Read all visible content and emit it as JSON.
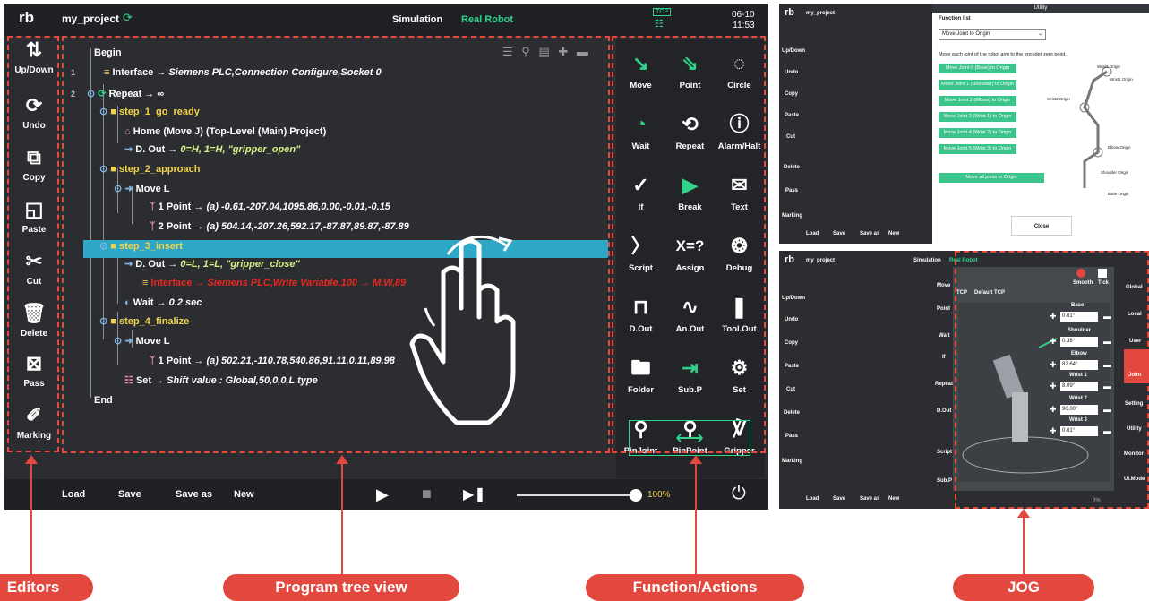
{
  "app": {
    "project": "my_project",
    "tab_sim": "Simulation",
    "tab_real": "Real Robot",
    "tcp": "TCP",
    "date": "06-10",
    "time": "11:53"
  },
  "tools": [
    {
      "label": "Up/Down",
      "icon": "up-down-icon"
    },
    {
      "label": "Undo",
      "icon": "undo-icon"
    },
    {
      "label": "Copy",
      "icon": "copy-icon"
    },
    {
      "label": "Paste",
      "icon": "paste-icon"
    },
    {
      "label": "Cut",
      "icon": "cut-icon"
    },
    {
      "label": "Delete",
      "icon": "delete-icon"
    },
    {
      "label": "Pass",
      "icon": "pass-icon"
    },
    {
      "label": "Marking",
      "icon": "marking-icon"
    }
  ],
  "tree": {
    "begin": "Begin",
    "end": "End",
    "rows": [
      {
        "num": "1",
        "text": "Interface → ",
        "detail": "Siemens PLC,Connection Configure,Socket 0"
      },
      {
        "num": "2",
        "text": "Repeat → ∞",
        "detail": ""
      },
      {
        "text": "step_1_go_ready",
        "detail": ""
      },
      {
        "text": "Home (Move J) (Top-Level (Main) Project)",
        "detail": ""
      },
      {
        "text": "D. Out → ",
        "detail": "0=H, 1=H, \"gripper_open\""
      },
      {
        "text": "step_2_approach",
        "detail": ""
      },
      {
        "text": "Move L",
        "detail": ""
      },
      {
        "text": "1 Point → ",
        "detail": "(a) -0.61,-207.04,1095.86,0.00,-0.01,-0.15"
      },
      {
        "text": "2 Point → ",
        "detail": "(a) 504.14,-207.26,592.17,-87.87,89.87,-87.89"
      },
      {
        "text": "step_3_insert",
        "detail": ""
      },
      {
        "text": "D. Out → ",
        "detail": "0=L, 1=L, \"gripper_close\""
      },
      {
        "text": "Interface → ",
        "detail": "Siemens PLC,Write Variable,100 → M.W,89"
      },
      {
        "text": "Wait → ",
        "detail": "0.2 sec"
      },
      {
        "text": "step_4_finalize",
        "detail": ""
      },
      {
        "text": "Move L",
        "detail": ""
      },
      {
        "text": "1 Point → ",
        "detail": "(a) 502.21,-110.78,540.86,91.11,0.11,89.98"
      },
      {
        "text": "Set → ",
        "detail": "Shift value : Global,50,0,0,L type"
      }
    ]
  },
  "functions": [
    {
      "label": "Move",
      "icon": "move-arrow-icon"
    },
    {
      "label": "Point",
      "icon": "point-icon"
    },
    {
      "label": "Circle",
      "icon": "circle-icon"
    },
    {
      "label": "Wait",
      "icon": "wait-icon"
    },
    {
      "label": "Repeat",
      "icon": "repeat-icon"
    },
    {
      "label": "Alarm/Halt",
      "icon": "alarm-icon"
    },
    {
      "label": "If",
      "icon": "if-icon"
    },
    {
      "label": "Break",
      "icon": "break-icon"
    },
    {
      "label": "Text",
      "icon": "text-icon"
    },
    {
      "label": "Script",
      "icon": "script-icon"
    },
    {
      "label": "Assign",
      "icon": "assign-icon"
    },
    {
      "label": "Debug",
      "icon": "debug-icon"
    },
    {
      "label": "D.Out",
      "icon": "dout-icon"
    },
    {
      "label": "An.Out",
      "icon": "anout-icon"
    },
    {
      "label": "Tool.Out",
      "icon": "toolout-icon"
    },
    {
      "label": "Folder",
      "icon": "folder-icon"
    },
    {
      "label": "Sub.P",
      "icon": "subp-icon"
    },
    {
      "label": "Set",
      "icon": "set-gear-icon"
    },
    {
      "label": "PinJoint",
      "icon": "pinjoint-icon"
    },
    {
      "label": "PinPoint",
      "icon": "pinpoint-icon"
    },
    {
      "label": "Gripper",
      "icon": "gripper-icon"
    }
  ],
  "bottom": {
    "load": "Load",
    "save": "Save",
    "saveas": "Save as",
    "new": "New",
    "speed": "100%"
  },
  "callouts": {
    "editors": "Editors",
    "tree": "Program tree view",
    "functions": "Function/Actions",
    "jog": "JOG"
  },
  "utility": {
    "title": "Utility",
    "fn_list_label": "Function list",
    "selected": "Move Joint to Origin",
    "desc": "Move each joint of the robot arm to the encoder zero point.",
    "buttons": [
      "Move Joint 0 (Base) to Origin",
      "Move Joint 1 (Shoulder) to Origin",
      "Move Joint 2 (Elbow) to Origin",
      "Move Joint 3 (Wrist 1) to Origin",
      "Move Joint 4 (Wrist 2) to Origin",
      "Move Joint 5 (Wrist 3) to Origin"
    ],
    "all": "Move all joints to Origin",
    "close": "Close",
    "diagram_labels": [
      "Wrist3 Origin",
      "Wrist1 Origin",
      "Wrist2 Origin",
      "Elbow Origin",
      "Shoulder Origin",
      "Base Origin"
    ]
  },
  "jog": {
    "smooth": "Smooth",
    "tick": "Tick",
    "tcp": "TCP",
    "tcp_val": "Default TCP",
    "joints": [
      {
        "name": "Base",
        "val": "0.01°"
      },
      {
        "name": "Shoulder",
        "val": "0.38°"
      },
      {
        "name": "Elbow",
        "val": "82.64°"
      },
      {
        "name": "Wrist 1",
        "val": "8.09°"
      },
      {
        "name": "Wrist 2",
        "val": "90.00°"
      },
      {
        "name": "Wrist 3",
        "val": "0.01°"
      }
    ],
    "side": [
      "Global",
      "Local",
      "User",
      "Joint",
      "Setting",
      "Utility",
      "Monitor",
      "UI.Mode"
    ],
    "speed": "0%"
  }
}
